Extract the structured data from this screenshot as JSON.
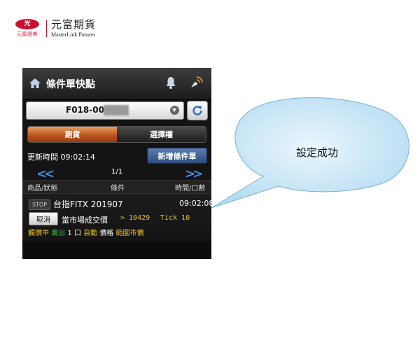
{
  "logo": {
    "seal_text": "光",
    "sub_text": "元富證券",
    "cn_name": "元富期貨",
    "en_name": "MasterLink Futures"
  },
  "app": {
    "title": "條件單快點",
    "account_value": "F018-000",
    "tabs": [
      {
        "label": "期貨",
        "active": true
      },
      {
        "label": "選擇權",
        "active": false
      }
    ],
    "update_time_label": "更新時間 09:02:14",
    "add_order_button": "新增條件單",
    "pager": {
      "prev": "<<",
      "text": "1/1",
      "next": ">>"
    },
    "columns": [
      "商品/狀態",
      "條件",
      "時間/口數"
    ],
    "order": {
      "type_tag": "STOP",
      "product": "台指FITX 201907",
      "time": "09:02:08",
      "cancel_label": "取消",
      "condition_label": "當市場成交價",
      "condition_expr": "> 10429",
      "tick": "Tick 10",
      "status": "觸價中",
      "side": "賣出",
      "qty": "1",
      "unit": "口",
      "mode": "自動",
      "price_label": "價格",
      "price_type": "範圍市價"
    }
  },
  "callout": {
    "text": "設定成功"
  },
  "colors": {
    "active_tab": "#c0581e",
    "add_button": "#3a5e94",
    "highlight_yellow": "#e8c21c",
    "highlight_green": "#22c82c",
    "callout_fill": "#c8e6f7",
    "brand_red": "#c8102e"
  }
}
